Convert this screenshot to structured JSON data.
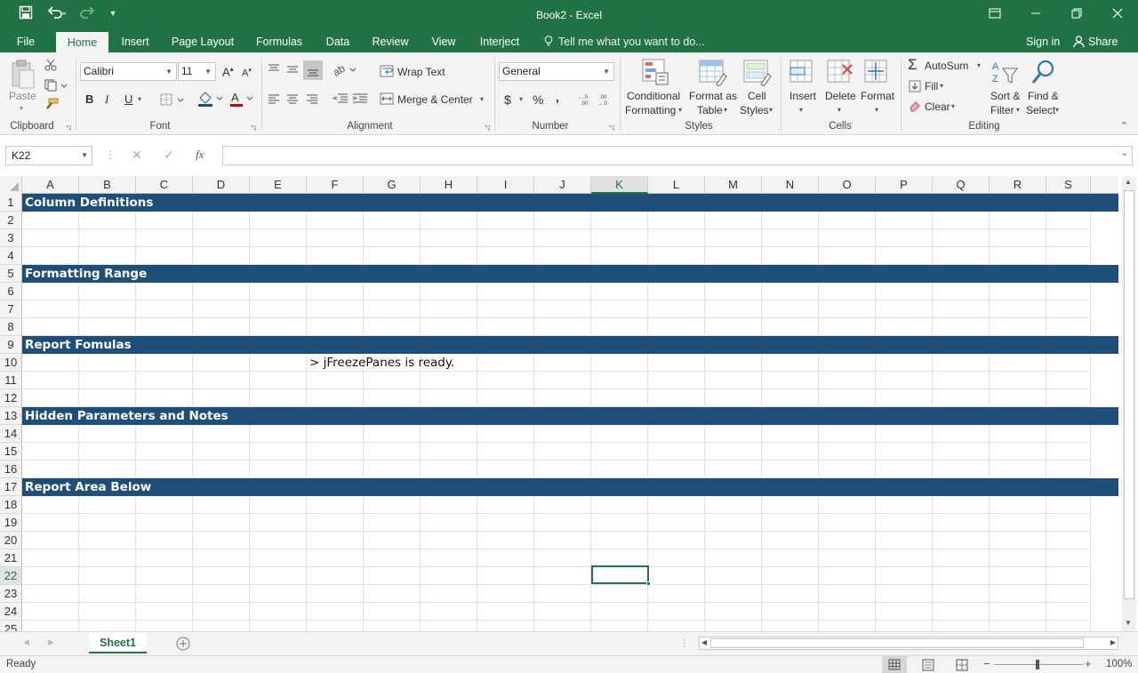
{
  "title": "Book2 - Excel",
  "quick_access": {
    "save_icon": "save-icon",
    "undo_icon": "undo-icon",
    "redo_icon": "redo-icon"
  },
  "menu": {
    "file": "File",
    "tabs": [
      "Home",
      "Insert",
      "Page Layout",
      "Formulas",
      "Data",
      "Review",
      "View",
      "Interject"
    ],
    "active_tab": "Home",
    "tell_me": "Tell me what you want to do...",
    "sign_in": "Sign in",
    "share": "Share"
  },
  "ribbon": {
    "clipboard": {
      "label": "Clipboard",
      "paste": "Paste"
    },
    "font": {
      "label": "Font",
      "font_name": "Calibri",
      "font_size": "11",
      "bold": "B",
      "italic": "I",
      "underline": "U"
    },
    "alignment": {
      "label": "Alignment",
      "wrap_text": "Wrap Text",
      "merge_center": "Merge & Center"
    },
    "number": {
      "label": "Number",
      "format": "General",
      "currency": "$",
      "percent": "%",
      "comma": ","
    },
    "styles": {
      "label": "Styles",
      "conditional": [
        "Conditional",
        "Formatting"
      ],
      "format_table": [
        "Format as",
        "Table"
      ],
      "cell_styles": [
        "Cell",
        "Styles"
      ]
    },
    "cells": {
      "label": "Cells",
      "insert": "Insert",
      "delete": "Delete",
      "format": "Format"
    },
    "editing": {
      "label": "Editing",
      "autosum": "AutoSum",
      "fill": "Fill",
      "clear": "Clear",
      "sort_filter": [
        "Sort &",
        "Filter"
      ],
      "find_select": [
        "Find &",
        "Select"
      ]
    }
  },
  "formula_bar": {
    "name_box": "K22",
    "fx": "fx",
    "formula": ""
  },
  "grid": {
    "columns": [
      "A",
      "B",
      "C",
      "D",
      "E",
      "F",
      "G",
      "H",
      "I",
      "J",
      "K",
      "L",
      "M",
      "N",
      "O",
      "P",
      "Q",
      "R",
      "S"
    ],
    "selected_column": "K",
    "selected_row": "22",
    "rows": [
      "1",
      "2",
      "3",
      "4",
      "5",
      "6",
      "7",
      "8",
      "9",
      "10",
      "11",
      "12",
      "13",
      "14",
      "15",
      "16",
      "17",
      "18",
      "19",
      "20",
      "21",
      "22",
      "23",
      "24",
      "25"
    ],
    "bands": [
      {
        "row": 1,
        "text": "Column Definitions"
      },
      {
        "row": 5,
        "text": "Formatting Range"
      },
      {
        "row": 9,
        "text": "Report Fomulas"
      },
      {
        "row": 13,
        "text": "Hidden Parameters and Notes"
      },
      {
        "row": 17,
        "text": "Report Area Below"
      }
    ],
    "cell_f10": "> jFreezePanes is ready.",
    "band_color": "#1f4e79",
    "accent": "#217346"
  },
  "sheets": {
    "active": "Sheet1"
  },
  "status": {
    "ready": "Ready",
    "zoom": "100%"
  }
}
